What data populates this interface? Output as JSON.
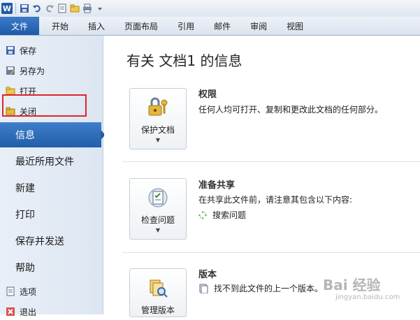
{
  "quick_access": {
    "logo": "W",
    "icons": [
      "save-icon",
      "undo-icon",
      "redo-icon",
      "new-doc-icon",
      "open-icon",
      "print-icon"
    ]
  },
  "ribbon": {
    "file_tab": "文件",
    "tabs": [
      "开始",
      "插入",
      "页面布局",
      "引用",
      "邮件",
      "审阅",
      "视图"
    ]
  },
  "nav": {
    "save": "保存",
    "save_as": "另存为",
    "open": "打开",
    "close": "关闭",
    "info": "信息",
    "recent": "最近所用文件",
    "new": "新建",
    "print": "打印",
    "save_send": "保存并发送",
    "help": "帮助",
    "options": "选项",
    "exit": "退出"
  },
  "content": {
    "title": "有关 文档1 的信息",
    "permissions": {
      "button_label": "保护文档",
      "title": "权限",
      "description": "任何人均可打开、复制和更改此文档的任何部分。"
    },
    "sharing": {
      "button_label": "检查问题",
      "title": "准备共享",
      "description": "在共享此文件前，请注意其包含以下内容:",
      "item": "搜索问题"
    },
    "versions": {
      "button_label": "管理版本",
      "title": "版本",
      "item": "找不到此文件的上一个版本。"
    }
  },
  "watermark": {
    "main": "Bai 经验",
    "sub": "jingyan.baidu.com"
  },
  "colors": {
    "accent": "#225ea9",
    "highlight": "#e0242b"
  }
}
